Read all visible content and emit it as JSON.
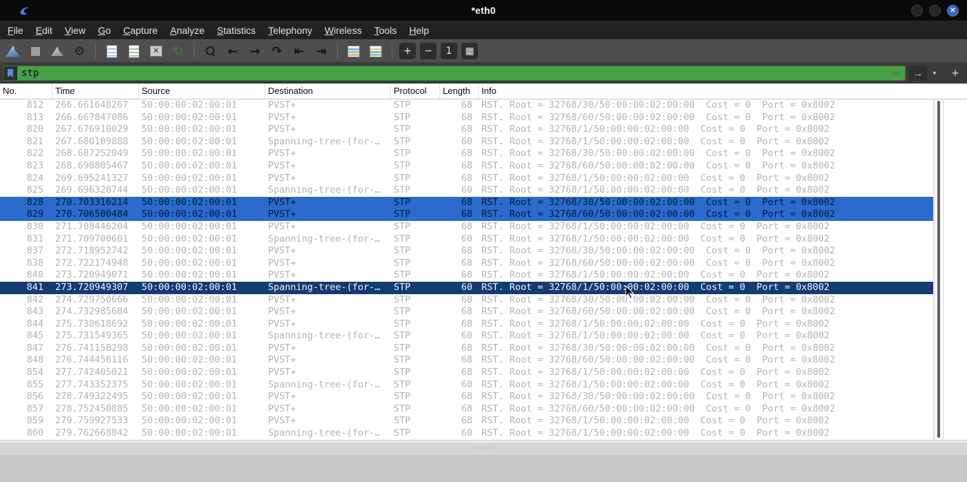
{
  "window": {
    "title": "*eth0",
    "controls": [
      {
        "name": "minimize-button",
        "kind": "k-circle",
        "glyph": ""
      },
      {
        "name": "maximize-button",
        "kind": "k-circle",
        "glyph": ""
      },
      {
        "name": "close-button",
        "kind": "k-close",
        "glyph": "✕"
      }
    ]
  },
  "menu_bar": {
    "items": [
      {
        "name": "menu-file",
        "label": "File"
      },
      {
        "name": "menu-edit",
        "label": "Edit"
      },
      {
        "name": "menu-view",
        "label": "View"
      },
      {
        "name": "menu-go",
        "label": "Go"
      },
      {
        "name": "menu-capture",
        "label": "Capture"
      },
      {
        "name": "menu-analyze",
        "label": "Analyze"
      },
      {
        "name": "menu-statistics",
        "label": "Statistics"
      },
      {
        "name": "menu-telephony",
        "label": "Telephony"
      },
      {
        "name": "menu-wireless",
        "label": "Wireless"
      },
      {
        "name": "menu-tools",
        "label": "Tools"
      },
      {
        "name": "menu-help",
        "label": "Help"
      }
    ]
  },
  "toolbar": {
    "icons": [
      {
        "name": "start-capture-fin-icon",
        "kind": "k-fin",
        "glyph": ""
      },
      {
        "name": "stop-capture-icon",
        "kind": "k-stop",
        "glyph": ""
      },
      {
        "name": "restart-capture-icon",
        "kind": "k-fin2",
        "glyph": ""
      },
      {
        "name": "capture-options-gear-icon",
        "kind": "k-gear",
        "glyph": "⚙"
      },
      {
        "name": "toolbar-separator",
        "kind": "k-sep",
        "glyph": "",
        "interactable": false
      },
      {
        "name": "open-file-icon",
        "kind": "k-doc",
        "glyph": ""
      },
      {
        "name": "save-file-icon",
        "kind": "k-doc2",
        "glyph": ""
      },
      {
        "name": "close-file-icon",
        "kind": "k-closefile",
        "glyph": "✕"
      },
      {
        "name": "reload-icon",
        "kind": "k-reload",
        "glyph": "↻"
      },
      {
        "name": "toolbar-separator",
        "kind": "k-sep",
        "glyph": "",
        "interactable": false
      },
      {
        "name": "find-packet-icon",
        "kind": "k-search",
        "glyph": ""
      },
      {
        "name": "go-back-icon",
        "kind": "k-glyph-lg",
        "glyph": "←"
      },
      {
        "name": "go-forward-icon",
        "kind": "k-glyph-lg",
        "glyph": "→"
      },
      {
        "name": "go-to-packet-icon",
        "kind": "k-glyph-lg",
        "glyph": "↷"
      },
      {
        "name": "go-first-packet-icon",
        "kind": "k-glyph-lg",
        "glyph": "⇤"
      },
      {
        "name": "go-last-packet-icon",
        "kind": "k-glyph-lg",
        "glyph": "⇥"
      },
      {
        "name": "toolbar-separator",
        "kind": "k-sep",
        "glyph": "",
        "interactable": false
      },
      {
        "name": "auto-scroll-icon",
        "kind": "k-colorlist",
        "glyph": ""
      },
      {
        "name": "colorize-packets-icon",
        "kind": "k-colorlist2",
        "glyph": ""
      },
      {
        "name": "toolbar-separator",
        "kind": "k-sep",
        "glyph": "",
        "interactable": false
      },
      {
        "name": "zoom-in-icon",
        "kind": "k-btn",
        "glyph": "+"
      },
      {
        "name": "zoom-out-icon",
        "kind": "k-btn",
        "glyph": "−"
      },
      {
        "name": "zoom-original-icon",
        "kind": "k-btn",
        "glyph": "1"
      },
      {
        "name": "resize-columns-icon",
        "kind": "k-btn",
        "glyph": "▦"
      }
    ]
  },
  "filter_bar": {
    "value": "stp",
    "clear_symbol": "⊗",
    "apply_symbol": "→",
    "dropdown_symbol": "▾",
    "add_button": "+",
    "valid_color": "#46a047"
  },
  "packet_list": {
    "columns": [
      {
        "name": "column-no",
        "label": "No."
      },
      {
        "name": "column-time",
        "label": "Time"
      },
      {
        "name": "column-source",
        "label": "Source"
      },
      {
        "name": "column-destination",
        "label": "Destination"
      },
      {
        "name": "column-protocol",
        "label": "Protocol"
      },
      {
        "name": "column-length",
        "label": "Length"
      },
      {
        "name": "column-info",
        "label": "Info"
      }
    ],
    "rows": [
      {
        "name": "packet-row-812",
        "no": "812",
        "time": "266.661648267",
        "source": "50:00:00:02:00:01",
        "destination": "PVST+",
        "protocol": "STP",
        "length": "68",
        "info": "RST. Root = 32768/30/50:00:00:02:00:00  Cost = 0  Port = 0x8002"
      },
      {
        "name": "packet-row-813",
        "no": "813",
        "time": "266.667847086",
        "source": "50:00:00:02:00:01",
        "destination": "PVST+",
        "protocol": "STP",
        "length": "68",
        "info": "RST. Root = 32768/60/50:00:00:02:00:00  Cost = 0  Port = 0x8002"
      },
      {
        "name": "packet-row-820",
        "no": "820",
        "time": "267.676910029",
        "source": "50:00:00:02:00:01",
        "destination": "PVST+",
        "protocol": "STP",
        "length": "68",
        "info": "RST. Root = 32768/1/50:00:00:02:00:00  Cost = 0  Port = 0x8002"
      },
      {
        "name": "packet-row-821",
        "no": "821",
        "time": "267.680109888",
        "source": "50:00:00:02:00:01",
        "destination": "Spanning-tree-(for-…",
        "protocol": "STP",
        "length": "60",
        "info": "RST. Root = 32768/1/50:00:00:02:00:00  Cost = 0  Port = 0x8002"
      },
      {
        "name": "packet-row-822",
        "no": "822",
        "time": "268.687252049",
        "source": "50:00:00:02:00:01",
        "destination": "PVST+",
        "protocol": "STP",
        "length": "68",
        "info": "RST. Root = 32768/30/50:00:00:02:00:00  Cost = 0  Port = 0x8002"
      },
      {
        "name": "packet-row-823",
        "no": "823",
        "time": "268.690805467",
        "source": "50:00:00:02:00:01",
        "destination": "PVST+",
        "protocol": "STP",
        "length": "68",
        "info": "RST. Root = 32768/60/50:00:00:02:00:00  Cost = 0  Port = 0x8002"
      },
      {
        "name": "packet-row-824",
        "no": "824",
        "time": "269.695241327",
        "source": "50:00:00:02:00:01",
        "destination": "PVST+",
        "protocol": "STP",
        "length": "68",
        "info": "RST. Root = 32768/1/50:00:00:02:00:00  Cost = 0  Port = 0x8002"
      },
      {
        "name": "packet-row-825",
        "no": "825",
        "time": "269.696328744",
        "source": "50:00:00:02:00:01",
        "destination": "Spanning-tree-(for-…",
        "protocol": "STP",
        "length": "60",
        "info": "RST. Root = 32768/1/50:00:00:02:00:00  Cost = 0  Port = 0x8002"
      },
      {
        "name": "packet-row-828",
        "no": "828",
        "time": "270.703316214",
        "source": "50:00:00:02:00:01",
        "destination": "PVST+",
        "protocol": "STP",
        "length": "68",
        "info": "RST. Root = 32768/30/50:00:00:02:00:00  Cost = 0  Port = 0x8002",
        "state": "row-multiselect"
      },
      {
        "name": "packet-row-829",
        "no": "829",
        "time": "270.706500484",
        "source": "50:00:00:02:00:01",
        "destination": "PVST+",
        "protocol": "STP",
        "length": "68",
        "info": "RST. Root = 32768/60/50:00:00:02:00:00  Cost = 0  Port = 0x8002",
        "state": "row-multiselect"
      },
      {
        "name": "packet-row-830",
        "no": "830",
        "time": "271.708446204",
        "source": "50:00:00:02:00:01",
        "destination": "PVST+",
        "protocol": "STP",
        "length": "68",
        "info": "RST. Root = 32768/1/50:00:00:02:00:00  Cost = 0  Port = 0x8002"
      },
      {
        "name": "packet-row-831",
        "no": "831",
        "time": "271.709700601",
        "source": "50:00:00:02:00:01",
        "destination": "Spanning-tree-(for-…",
        "protocol": "STP",
        "length": "60",
        "info": "RST. Root = 32768/1/50:00:00:02:00:00  Cost = 0  Port = 0x8002"
      },
      {
        "name": "packet-row-837",
        "no": "837",
        "time": "272.718952742",
        "source": "50:00:00:02:00:01",
        "destination": "PVST+",
        "protocol": "STP",
        "length": "68",
        "info": "RST. Root = 32768/30/50:00:00:02:00:00  Cost = 0  Port = 0x8002"
      },
      {
        "name": "packet-row-838",
        "no": "838",
        "time": "272.722174948",
        "source": "50:00:00:02:00:01",
        "destination": "PVST+",
        "protocol": "STP",
        "length": "68",
        "info": "RST. Root = 32768/60/50:00:00:02:00:00  Cost = 0  Port = 0x8002"
      },
      {
        "name": "packet-row-840",
        "no": "840",
        "time": "273.720949071",
        "source": "50:00:00:02:00:01",
        "destination": "PVST+",
        "protocol": "STP",
        "length": "68",
        "info": "RST. Root = 32768/1/50:00:00:02:00:00  Cost = 0  Port = 0x8002"
      },
      {
        "name": "packet-row-841",
        "no": "841",
        "time": "273.720949307",
        "source": "50:00:00:02:00:01",
        "destination": "Spanning-tree-(for-…",
        "protocol": "STP",
        "length": "60",
        "info": "RST. Root = 32768/1/50:00:00:02:00:00  Cost = 0  Port = 0x8002",
        "state": "row-selected"
      },
      {
        "name": "packet-row-842",
        "no": "842",
        "time": "274.729750666",
        "source": "50:00:00:02:00:01",
        "destination": "PVST+",
        "protocol": "STP",
        "length": "68",
        "info": "RST. Root = 32768/30/50:00:00:02:00:00  Cost = 0  Port = 0x8002"
      },
      {
        "name": "packet-row-843",
        "no": "843",
        "time": "274.732985684",
        "source": "50:00:00:02:00:01",
        "destination": "PVST+",
        "protocol": "STP",
        "length": "68",
        "info": "RST. Root = 32768/60/50:00:00:02:00:00  Cost = 0  Port = 0x8002"
      },
      {
        "name": "packet-row-844",
        "no": "844",
        "time": "275.730618692",
        "source": "50:00:00:02:00:01",
        "destination": "PVST+",
        "protocol": "STP",
        "length": "68",
        "info": "RST. Root = 32768/1/50:00:00:02:00:00  Cost = 0  Port = 0x8002"
      },
      {
        "name": "packet-row-845",
        "no": "845",
        "time": "275.731549365",
        "source": "50:00:00:02:00:01",
        "destination": "Spanning-tree-(for-…",
        "protocol": "STP",
        "length": "60",
        "info": "RST. Root = 32768/1/50:00:00:02:00:00  Cost = 0  Port = 0x8002"
      },
      {
        "name": "packet-row-847",
        "no": "847",
        "time": "276.741158298",
        "source": "50:00:00:02:00:01",
        "destination": "PVST+",
        "protocol": "STP",
        "length": "68",
        "info": "RST. Root = 32768/30/50:00:00:02:00:00  Cost = 0  Port = 0x8002"
      },
      {
        "name": "packet-row-848",
        "no": "848",
        "time": "276.744456116",
        "source": "50:00:00:02:00:01",
        "destination": "PVST+",
        "protocol": "STP",
        "length": "68",
        "info": "RST. Root = 32768/60/50:00:00:02:00:00  Cost = 0  Port = 0x8002"
      },
      {
        "name": "packet-row-854",
        "no": "854",
        "time": "277.742405021",
        "source": "50:00:00:02:00:01",
        "destination": "PVST+",
        "protocol": "STP",
        "length": "68",
        "info": "RST. Root = 32768/1/50:00:00:02:00:00  Cost = 0  Port = 0x8002"
      },
      {
        "name": "packet-row-855",
        "no": "855",
        "time": "277.743352375",
        "source": "50:00:00:02:00:01",
        "destination": "Spanning-tree-(for-…",
        "protocol": "STP",
        "length": "60",
        "info": "RST. Root = 32768/1/50:00:00:02:00:00  Cost = 0  Port = 0x8002"
      },
      {
        "name": "packet-row-856",
        "no": "856",
        "time": "278.749322495",
        "source": "50:00:00:02:00:01",
        "destination": "PVST+",
        "protocol": "STP",
        "length": "68",
        "info": "RST. Root = 32768/30/50:00:00:02:00:00  Cost = 0  Port = 0x8002"
      },
      {
        "name": "packet-row-857",
        "no": "857",
        "time": "278.752450885",
        "source": "50:00:00:02:00:01",
        "destination": "PVST+",
        "protocol": "STP",
        "length": "68",
        "info": "RST. Root = 32768/60/50:00:00:02:00:00  Cost = 0  Port = 0x8002"
      },
      {
        "name": "packet-row-859",
        "no": "859",
        "time": "279.759927533",
        "source": "50:00:00:02:00:01",
        "destination": "PVST+",
        "protocol": "STP",
        "length": "68",
        "info": "RST. Root = 32768/1/50:00:00:02:00:00  Cost = 0  Port = 0x8002"
      },
      {
        "name": "packet-row-860",
        "no": "860",
        "time": "279.762668842",
        "source": "50:00:00:02:00:01",
        "destination": "Spanning-tree-(for-…",
        "protocol": "STP",
        "length": "60",
        "info": "RST. Root = 32768/1/50:00:00:02:00:00  Cost = 0  Port = 0x8002"
      }
    ],
    "selection_colors": {
      "current": "#123c72",
      "multiselect": "#2a6bcd",
      "dimmed_text": "#b3b3b3"
    }
  },
  "splitter": {
    "handle": "······"
  }
}
